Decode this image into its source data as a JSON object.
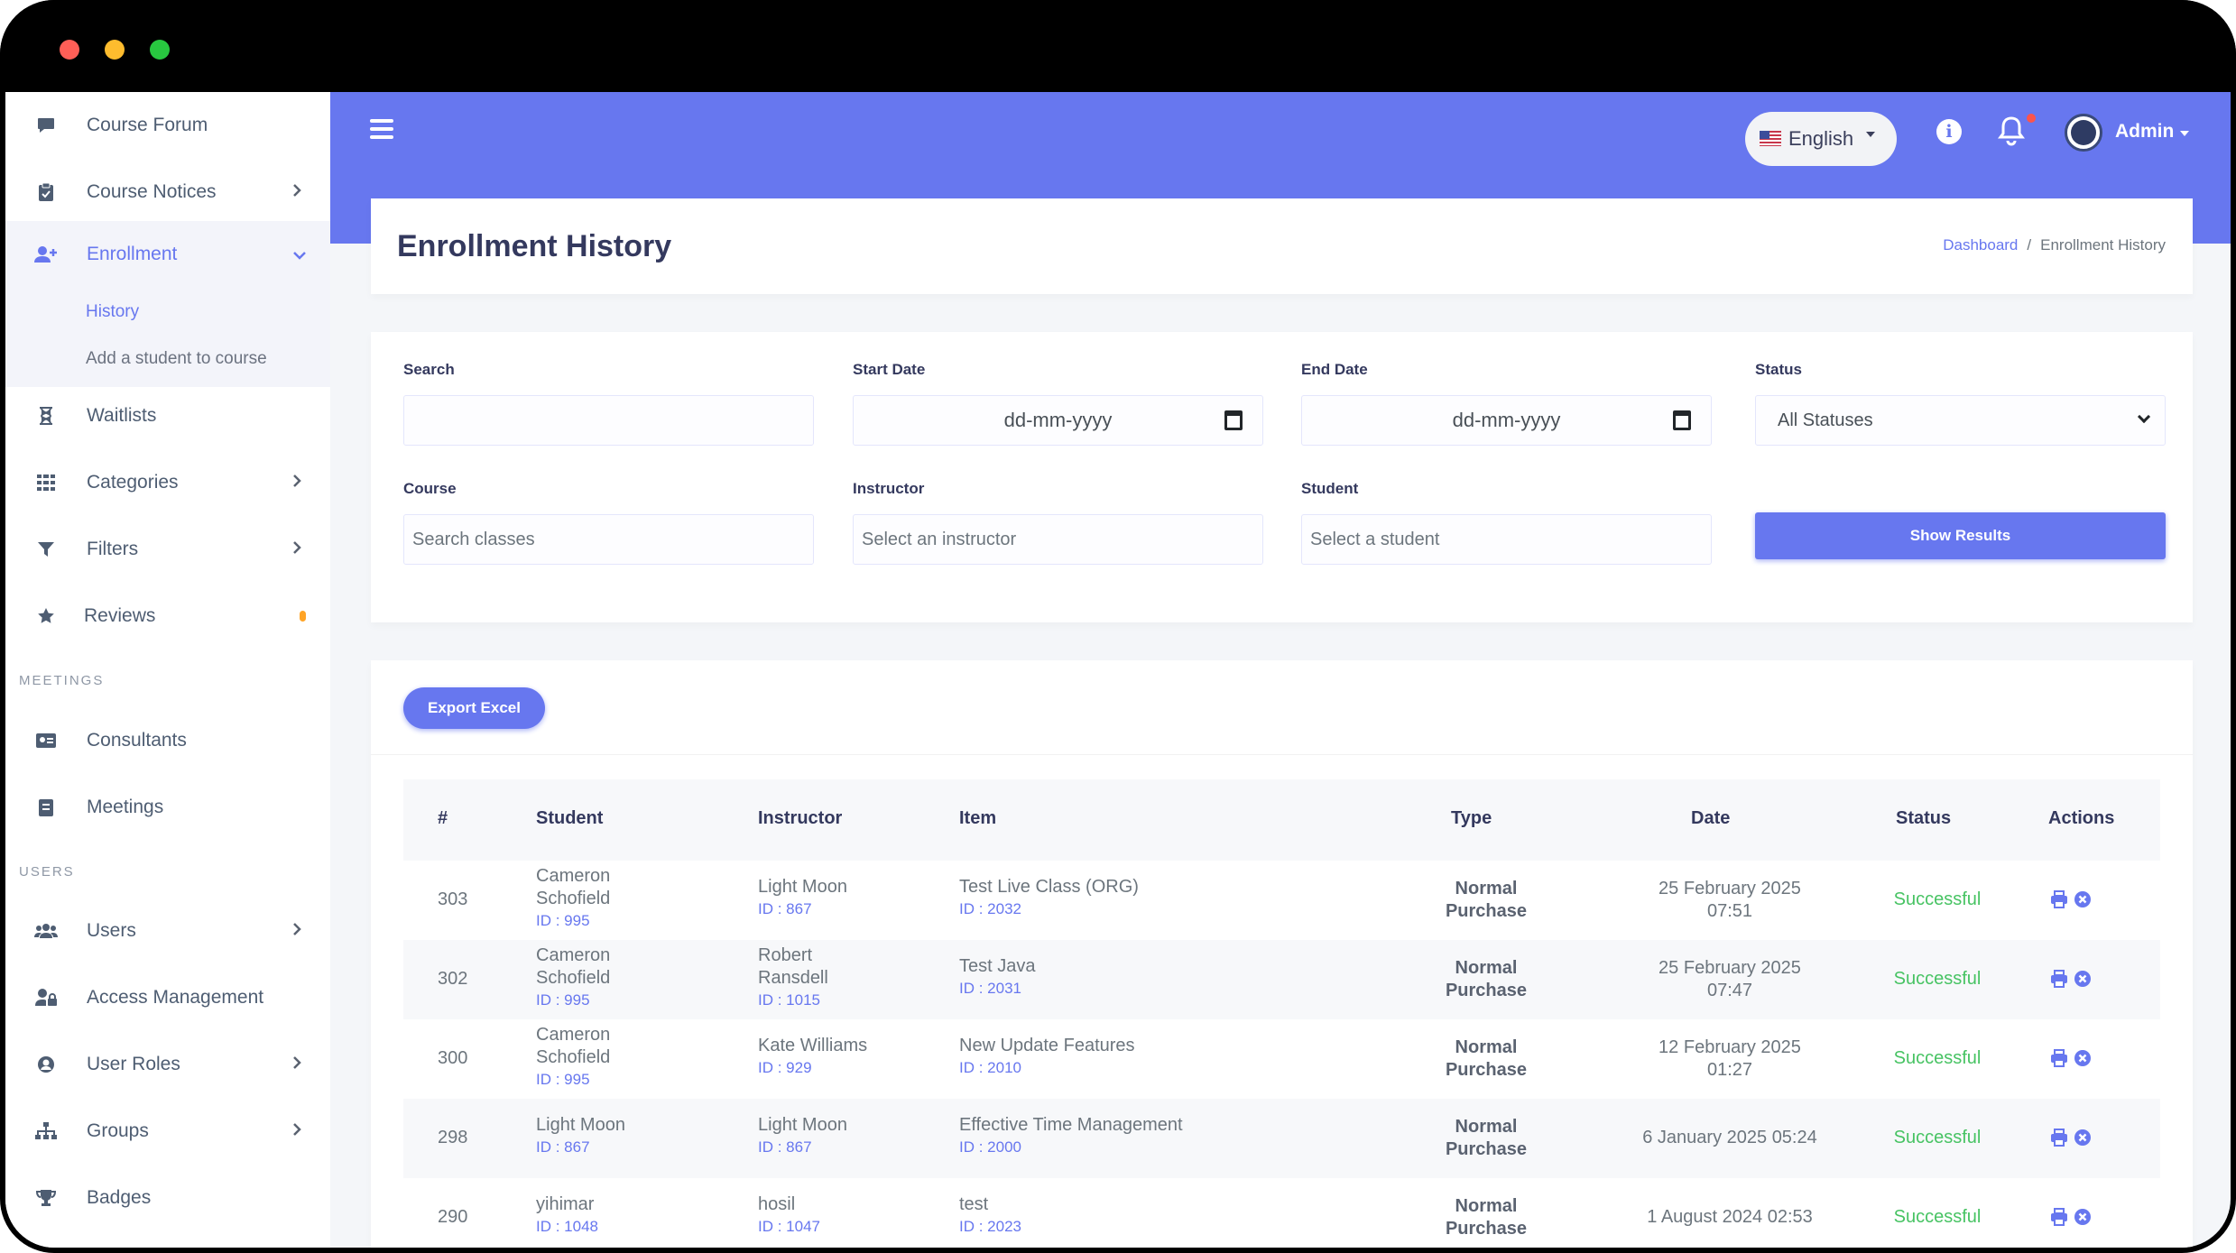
{
  "sidebar": {
    "items": [
      {
        "label": "Course Forum",
        "icon": "comment-icon"
      },
      {
        "label": "Course Notices",
        "icon": "clipboard-icon",
        "has_children": true
      },
      {
        "label": "Enrollment",
        "icon": "user-plus-icon",
        "has_children": true,
        "active": true
      },
      {
        "label": "Waitlists",
        "icon": "hourglass-icon"
      },
      {
        "label": "Categories",
        "icon": "grid-icon",
        "has_children": true
      },
      {
        "label": "Filters",
        "icon": "filter-icon",
        "has_children": true
      },
      {
        "label": "Reviews",
        "icon": "star-icon"
      },
      {
        "label": "Consultants",
        "icon": "id-card-icon"
      },
      {
        "label": "Meetings",
        "icon": "calendar-icon"
      },
      {
        "label": "Users",
        "icon": "users-icon",
        "has_children": true
      },
      {
        "label": "Access Management",
        "icon": "user-lock-icon"
      },
      {
        "label": "User Roles",
        "icon": "user-circle-icon",
        "has_children": true
      },
      {
        "label": "Groups",
        "icon": "sitemap-icon",
        "has_children": true
      },
      {
        "label": "Badges",
        "icon": "trophy-icon"
      }
    ],
    "enrollment_sub": [
      "History",
      "Add a student to course"
    ],
    "sections": [
      "MEETINGS",
      "USERS"
    ]
  },
  "header": {
    "language": "English",
    "user_name": "Admin",
    "colors": {
      "primary": "#6777ef",
      "success": "#47c363"
    }
  },
  "page": {
    "title": "Enrollment History",
    "breadcrumb": [
      "Dashboard",
      "Enrollment History"
    ]
  },
  "filters": {
    "search_label": "Search",
    "search_value": "",
    "start_label": "Start Date",
    "start_placeholder": "dd-mm-yyyy",
    "end_label": "End Date",
    "end_placeholder": "dd-mm-yyyy",
    "status_label": "Status",
    "status_value": "All Statuses",
    "course_label": "Course",
    "course_placeholder": "Search classes",
    "instructor_label": "Instructor",
    "instructor_placeholder": "Select an instructor",
    "student_label": "Student",
    "student_placeholder": "Select a student",
    "submit_label": "Show Results"
  },
  "table": {
    "export_label": "Export Excel",
    "columns": [
      "#",
      "Student",
      "Instructor",
      "Item",
      "Type",
      "Date",
      "Status",
      "Actions"
    ],
    "rows": [
      {
        "num": "303",
        "student": [
          "Cameron",
          "Schofield"
        ],
        "student_id": "ID : 995",
        "instructor": [
          "Light Moon"
        ],
        "instructor_id": "ID : 867",
        "item": "Test Live Class (ORG)",
        "item_id": "ID : 2032",
        "type": [
          "Normal",
          "Purchase"
        ],
        "date": [
          "25 February 2025",
          "07:51"
        ],
        "status": "Successful"
      },
      {
        "num": "302",
        "student": [
          "Cameron",
          "Schofield"
        ],
        "student_id": "ID : 995",
        "instructor": [
          "Robert",
          "Ransdell"
        ],
        "instructor_id": "ID : 1015",
        "item": "Test Java",
        "item_id": "ID : 2031",
        "type": [
          "Normal",
          "Purchase"
        ],
        "date": [
          "25 February 2025",
          "07:47"
        ],
        "status": "Successful"
      },
      {
        "num": "300",
        "student": [
          "Cameron",
          "Schofield"
        ],
        "student_id": "ID : 995",
        "instructor": [
          "Kate Williams"
        ],
        "instructor_id": "ID : 929",
        "item": "New Update Features",
        "item_id": "ID : 2010",
        "type": [
          "Normal",
          "Purchase"
        ],
        "date": [
          "12 February 2025",
          "01:27"
        ],
        "status": "Successful"
      },
      {
        "num": "298",
        "student": [
          "Light Moon"
        ],
        "student_id": "ID : 867",
        "instructor": [
          "Light Moon"
        ],
        "instructor_id": "ID : 867",
        "item": "Effective Time Management",
        "item_id": "ID : 2000",
        "type": [
          "Normal",
          "Purchase"
        ],
        "date": [
          "6 January 2025 05:24"
        ],
        "status": "Successful"
      },
      {
        "num": "290",
        "student": [
          "yihimar"
        ],
        "student_id": "ID : 1048",
        "instructor": [
          "hosil"
        ],
        "instructor_id": "ID : 1047",
        "item": "test",
        "item_id": "ID : 2023",
        "type": [
          "Normal",
          "Purchase"
        ],
        "date": [
          "1 August 2024 02:53"
        ],
        "status": "Successful"
      }
    ]
  }
}
